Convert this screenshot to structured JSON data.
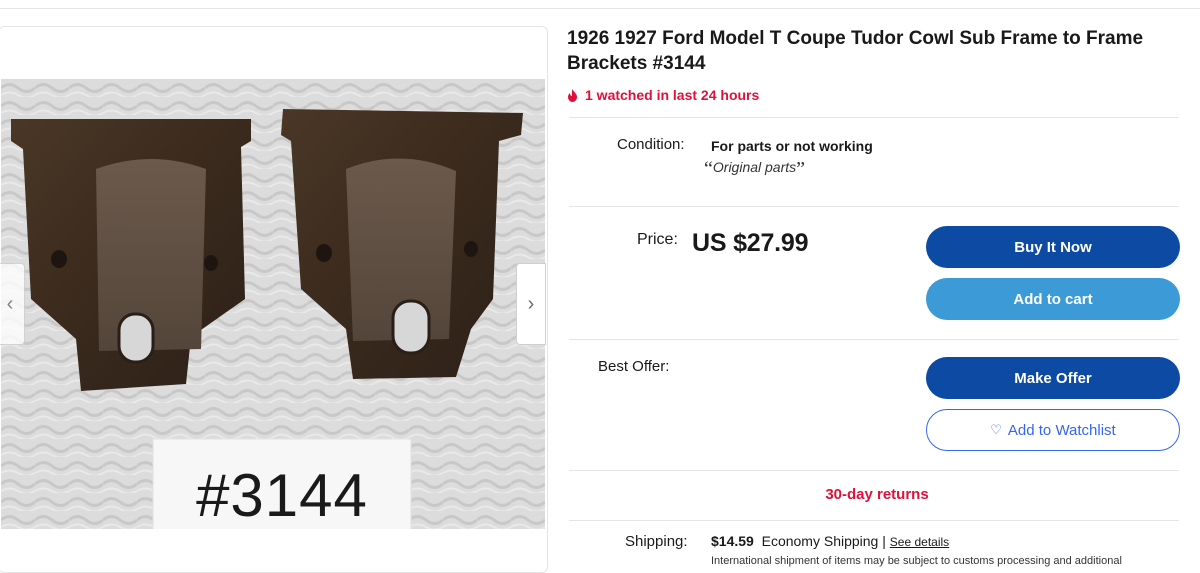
{
  "listing": {
    "title": "1926 1927 Ford Model T Coupe Tudor Cowl Sub Frame to Frame Brackets #3144",
    "watch_text": "1 watched in last 24 hours",
    "photo_label": "#3144"
  },
  "gallery": {
    "prev_icon": "‹",
    "next_icon": "›"
  },
  "condition": {
    "label": "Condition:",
    "value": "For parts or not working",
    "note": "Original parts"
  },
  "price": {
    "label": "Price:",
    "value": "US $27.99"
  },
  "actions": {
    "buy_now": "Buy It Now",
    "add_to_cart": "Add to cart",
    "make_offer": "Make Offer",
    "add_to_watchlist": "Add to Watchlist"
  },
  "best_offer": {
    "label": "Best Offer:"
  },
  "returns": {
    "text": "30-day returns"
  },
  "shipping": {
    "label": "Shipping:",
    "price": "$14.59",
    "method": "Economy Shipping",
    "separator": "|",
    "details_link": "See details",
    "note": "International shipment of items may be subject to customs processing and additional"
  },
  "colors": {
    "primary_blue": "#0d4aa3",
    "secondary_blue": "#3c9ad6",
    "alert_red": "#e0103a",
    "link_blue": "#3665f3"
  }
}
